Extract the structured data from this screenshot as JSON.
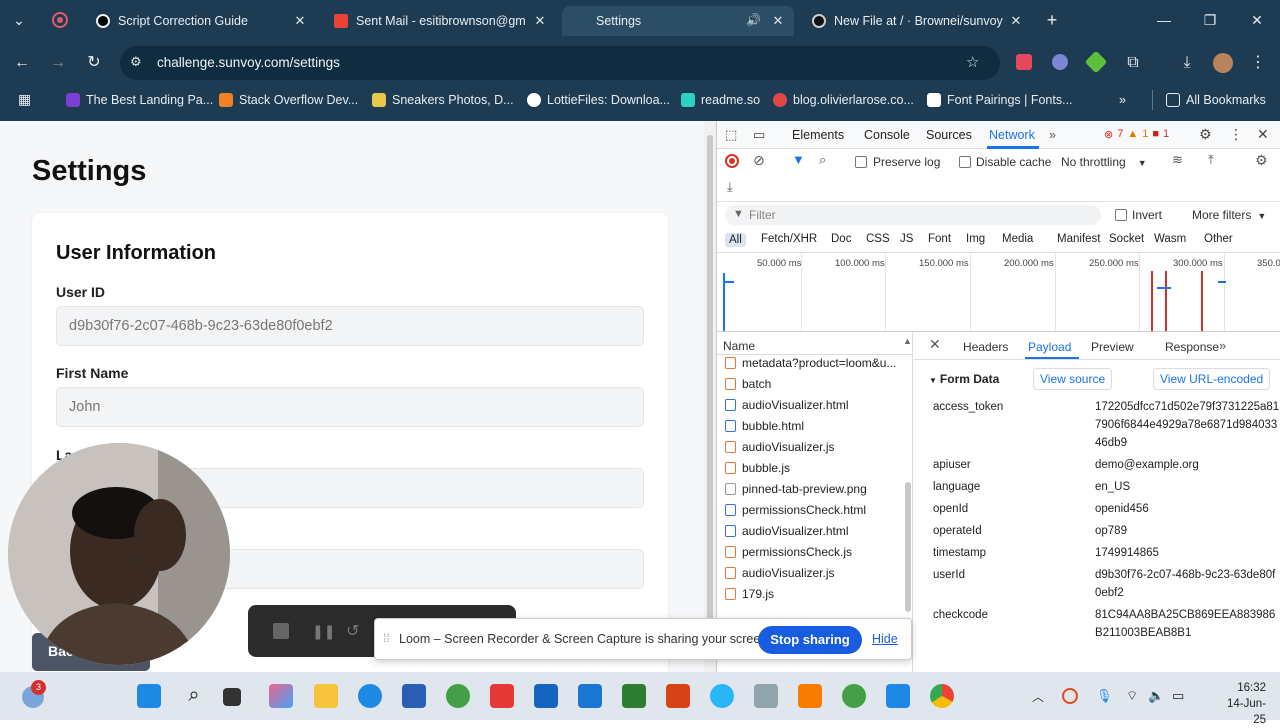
{
  "browser": {
    "tabs": [
      {
        "label": "Script Correction Guide",
        "active": false
      },
      {
        "label": "Sent Mail - esitibrownson@gm",
        "active": false
      },
      {
        "label": "Settings",
        "active": true
      },
      {
        "label": "New File at / · Brownei/sunvoy",
        "active": false
      }
    ],
    "url": "challenge.sunvoy.com/settings",
    "bookmarks": [
      "The Best Landing Pa...",
      "Stack Overflow Dev...",
      "Sneakers Photos, D...",
      "LottieFiles: Downloa...",
      "readme.so",
      "blog.olivierlarose.co...",
      "Font Pairings | Fonts..."
    ],
    "all_bookmarks": "All Bookmarks"
  },
  "page": {
    "title": "Settings",
    "section_title": "User Information",
    "user_id_label": "User ID",
    "user_id_value": "d9b30f76-2c07-468b-9c23-63de80f0ebf2",
    "first_name_label": "First Name",
    "first_name_value": "John",
    "last_name_label_partial": "La",
    "back_button_partial": "Bac"
  },
  "devtools": {
    "tabs": [
      "Elements",
      "Console",
      "Sources",
      "Network"
    ],
    "error_count": "7",
    "warning_count": "1",
    "info_count": "1",
    "preserve_log": "Preserve log",
    "disable_cache": "Disable cache",
    "throttling": "No throttling",
    "filter_placeholder": "Filter",
    "invert": "Invert",
    "more_filters": "More filters",
    "type_filters": [
      "All",
      "Fetch/XHR",
      "Doc",
      "CSS",
      "JS",
      "Font",
      "Img",
      "Media",
      "Manifest",
      "Socket",
      "Wasm",
      "Other"
    ],
    "timeline_ticks": [
      "50.000 ms",
      "100.000 ms",
      "150.000 ms",
      "200.000 ms",
      "250.000 ms",
      "300.000 ms",
      "350.0"
    ],
    "name_header": "Name",
    "requests": [
      {
        "name": "metadata?product=loom&u...",
        "color": "#e07a3d"
      },
      {
        "name": "batch",
        "color": "#e07a3d"
      },
      {
        "name": "audioVisualizer.html",
        "color": "#3a6fd8"
      },
      {
        "name": "bubble.html",
        "color": "#3a6fd8"
      },
      {
        "name": "audioVisualizer.js",
        "color": "#e07a3d"
      },
      {
        "name": "bubble.js",
        "color": "#e07a3d"
      },
      {
        "name": "pinned-tab-preview.png",
        "color": "#999999"
      },
      {
        "name": "permissionsCheck.html",
        "color": "#3a6fd8"
      },
      {
        "name": "audioVisualizer.html",
        "color": "#3a6fd8"
      },
      {
        "name": "permissionsCheck.js",
        "color": "#e07a3d"
      },
      {
        "name": "audioVisualizer.js",
        "color": "#e07a3d"
      },
      {
        "name": "179.js",
        "color": "#e07a3d"
      }
    ],
    "detail_tabs": [
      "Headers",
      "Payload",
      "Preview",
      "Response"
    ],
    "form_data_title": "Form Data",
    "view_source": "View source",
    "view_url_encoded": "View URL-encoded",
    "payload": [
      {
        "key": "access_token",
        "value": "172205dfcc71d502e79f3731225a817906f6844e4929a78e6871d98403346db9"
      },
      {
        "key": "apiuser",
        "value": "demo@example.org"
      },
      {
        "key": "language",
        "value": "en_US"
      },
      {
        "key": "openId",
        "value": "openid456"
      },
      {
        "key": "operateId",
        "value": "op789"
      },
      {
        "key": "timestamp",
        "value": "1749914865"
      },
      {
        "key": "userId",
        "value": "d9b30f76-2c07-468b-9c23-63de80f0ebf2"
      },
      {
        "key": "checkcode",
        "value": "81C94AA8BA25CB869EEA883986B211003BEAB8B1"
      }
    ]
  },
  "loom": {
    "message": "Loom – Screen Recorder & Screen Capture is sharing your screen.",
    "stop_button": "Stop sharing",
    "hide_link": "Hide"
  },
  "taskbar": {
    "badge": "3",
    "time": "16:32",
    "date": "14-Jun-25"
  },
  "colors": {
    "chrome_bg": "#1d3b52",
    "accent": "#1a73e8",
    "loom_blue": "#1a5ce0"
  }
}
